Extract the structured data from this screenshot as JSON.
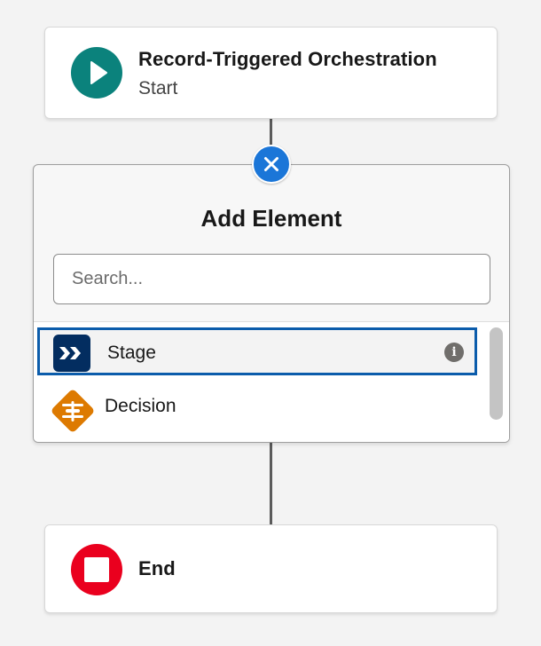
{
  "start_node": {
    "title": "Record-Triggered Orchestration",
    "subtitle": "Start",
    "icon": "play-icon",
    "color": "#0b827c"
  },
  "add_element_panel": {
    "title": "Add Element",
    "search": {
      "placeholder": "Search...",
      "value": ""
    },
    "items": [
      {
        "label": "Stage",
        "icon": "stage-icon",
        "color": "#032d60",
        "selected": true,
        "info_icon": "info-icon"
      },
      {
        "label": "Decision",
        "icon": "decision-icon",
        "color": "#dd7a01",
        "selected": false
      }
    ],
    "close_icon": "close-icon",
    "accent_color": "#1b76d8"
  },
  "end_node": {
    "title": "End",
    "icon": "stop-icon",
    "color": "#ea001e"
  }
}
